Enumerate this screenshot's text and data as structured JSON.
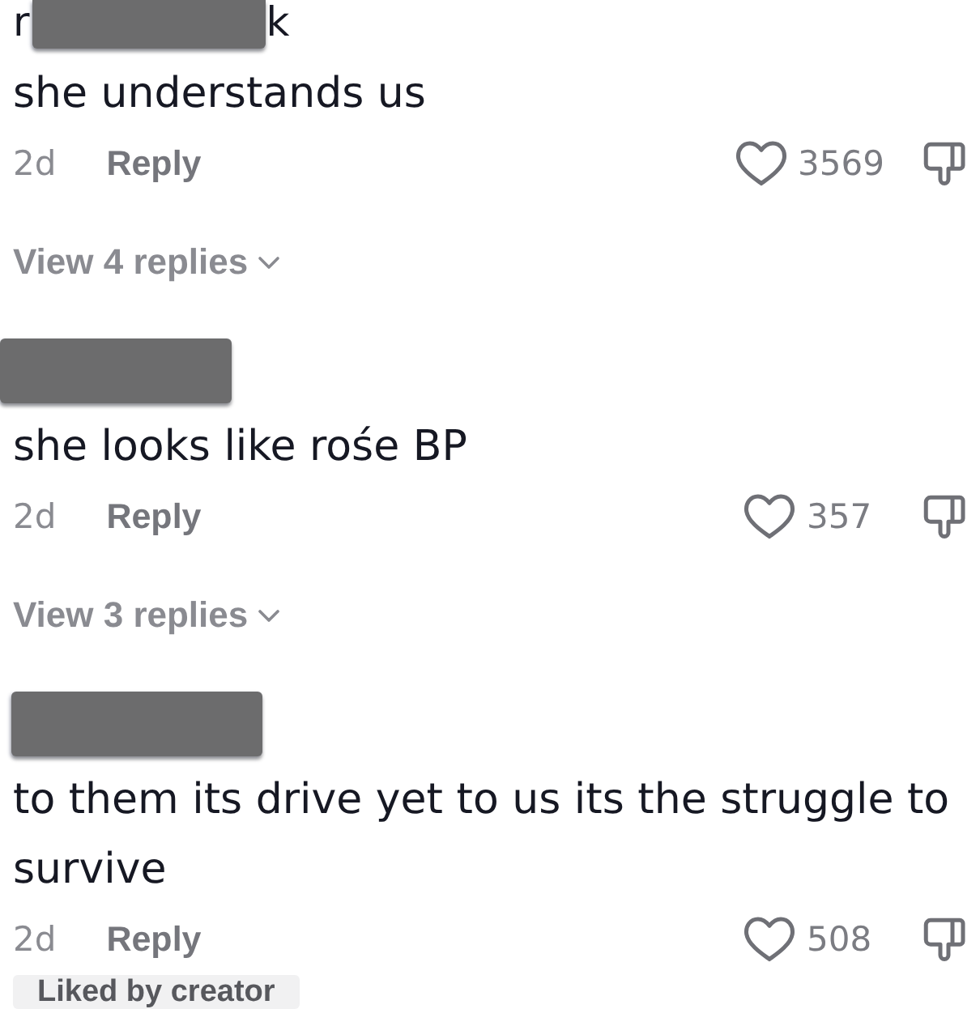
{
  "comments": [
    {
      "username": [
        {
          "kind": "text",
          "text": "r"
        },
        {
          "kind": "redacted"
        },
        {
          "kind": "text",
          "text": "k"
        }
      ],
      "text": "she understands us",
      "time": "2d",
      "reply": "Reply",
      "liked": false,
      "likes": "3569",
      "view_replies": "View 4 replies"
    },
    {
      "username": [
        {
          "kind": "redacted"
        }
      ],
      "text": "she looks like rośe BP",
      "time": "2d",
      "reply": "Reply",
      "liked": false,
      "likes": "357",
      "view_replies": "View 3 replies"
    },
    {
      "username": [
        {
          "kind": "redacted"
        }
      ],
      "text": "to them its drive yet to us its the struggle to survive",
      "time": "2d",
      "reply": "Reply",
      "liked": false,
      "likes": "508",
      "badge": "Liked by creator"
    }
  ]
}
